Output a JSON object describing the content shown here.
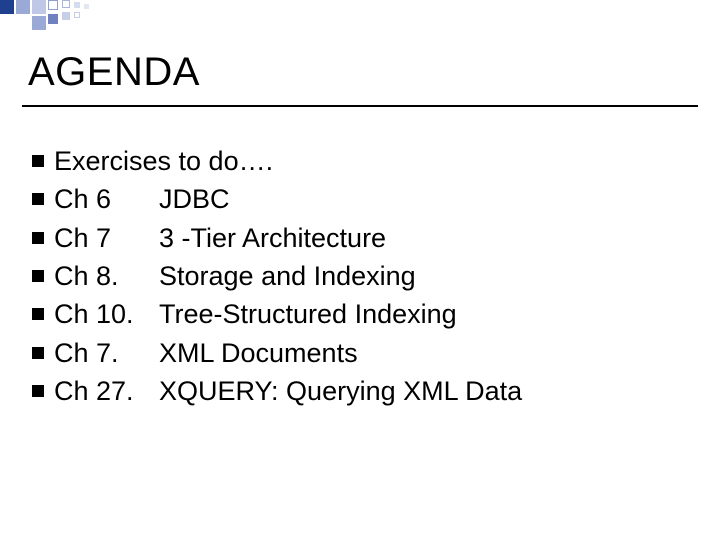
{
  "title": "AGENDA",
  "items": [
    {
      "text": "Exercises to do…."
    },
    {
      "chapter": "Ch 6",
      "topic": "JDBC"
    },
    {
      "chapter": "Ch 7",
      "topic": "3 -Tier Architecture"
    },
    {
      "chapter": "Ch 8.",
      "topic": "Storage and Indexing"
    },
    {
      "chapter": "Ch 10.",
      "topic": "Tree-Structured Indexing"
    },
    {
      "chapter": "Ch 7.",
      "topic": "XML Documents"
    },
    {
      "chapter": "Ch 27.",
      "topic": "XQUERY: Querying XML Data"
    }
  ]
}
